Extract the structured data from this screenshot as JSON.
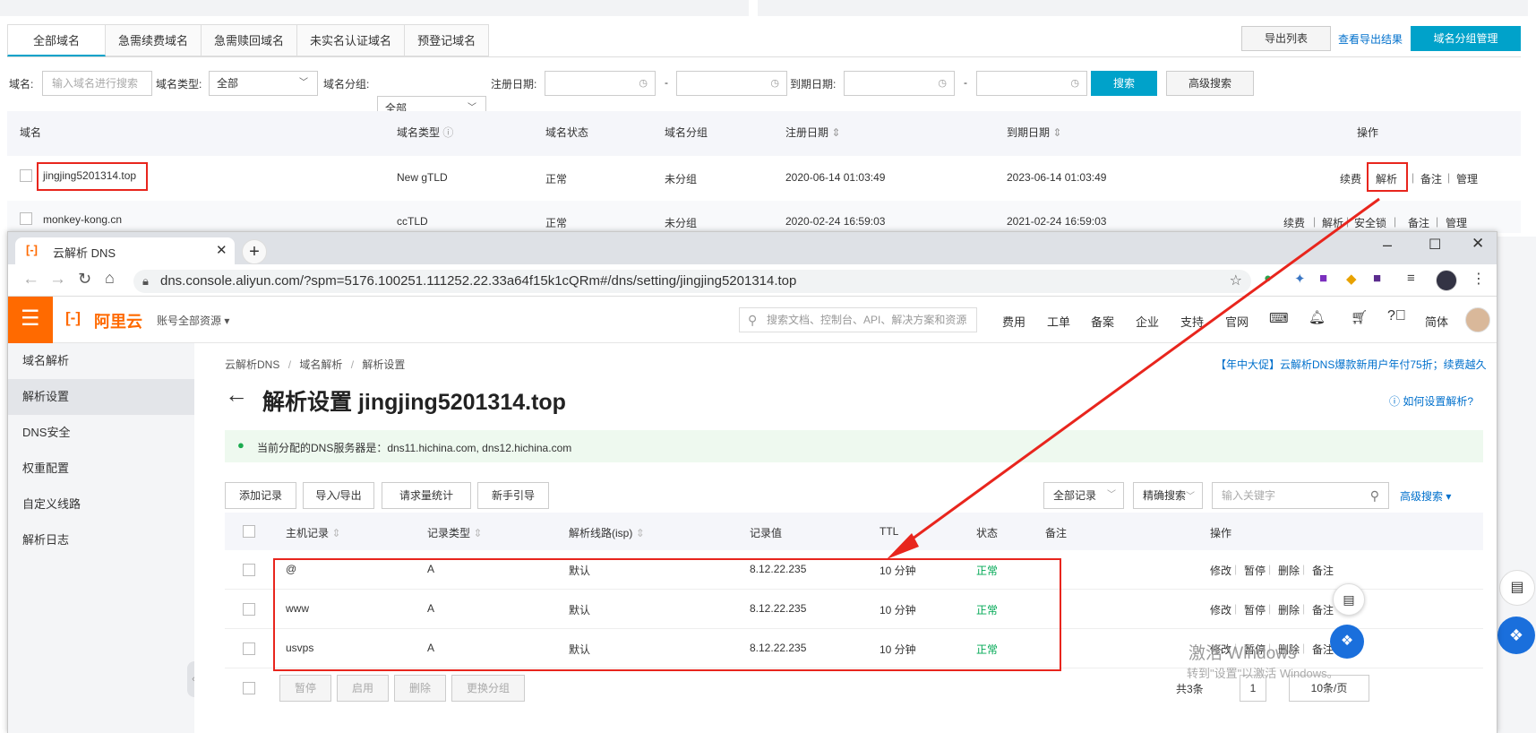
{
  "bg": {
    "tabs": [
      "全部域名",
      "急需续费域名",
      "急需赎回域名",
      "未实名认证域名",
      "预登记域名"
    ],
    "export_list": "导出列表",
    "view_export": "查看导出结果",
    "group_manage": "域名分组管理",
    "filters": {
      "domain_label": "域名:",
      "domain_placeholder": "输入域名进行搜索",
      "type_label": "域名类型:",
      "type_value": "全部",
      "group_label": "域名分组:",
      "group_value": "全部",
      "reg_label": "注册日期:",
      "dash": "-",
      "exp_label": "到期日期:",
      "search": "搜索",
      "advanced": "高级搜索"
    },
    "headers": [
      "域名",
      "域名类型",
      "域名状态",
      "域名分组",
      "注册日期",
      "到期日期",
      "操作"
    ],
    "rows": [
      {
        "domain": "jingjing5201314.top",
        "type": "New gTLD",
        "status": "正常",
        "group": "未分组",
        "reg": "2020-06-14 01:03:49",
        "exp": "2023-06-14 01:03:49",
        "ops": [
          "续费",
          "解析",
          "备注",
          "管理"
        ]
      },
      {
        "domain": "monkey-kong.cn",
        "type": "ccTLD",
        "status": "正常",
        "group": "未分组",
        "reg": "2020-02-24 16:59:03",
        "exp": "2021-02-24 16:59:03",
        "ops": [
          "续费",
          "解析",
          "安全锁",
          "备注",
          "管理"
        ]
      }
    ],
    "sep": "|"
  },
  "browser": {
    "tab_title": "云解析 DNS",
    "url": "dns.console.aliyun.com/?spm=5176.100251.111252.22.33a64f15k1cQRm#/dns/setting/jingjing5201314.top"
  },
  "app": {
    "logo": "阿里云",
    "account": "账号全部资源",
    "search_placeholder": "搜索文档、控制台、API、解决方案和资源",
    "nav": [
      "费用",
      "工单",
      "备案",
      "企业",
      "支持",
      "官网"
    ],
    "lang": "简体"
  },
  "sidebar": {
    "items": [
      "域名解析",
      "解析设置",
      "DNS安全",
      "权重配置",
      "自定义线路",
      "解析日志"
    ]
  },
  "main": {
    "breadcrumb": [
      "云解析DNS",
      "域名解析",
      "解析设置"
    ],
    "breadcrumb_sep": "/",
    "promo": "【年中大促】云解析DNS爆款新用户年付75折；续费越久",
    "title": "解析设置 jingjing5201314.top",
    "help": "如何设置解析?",
    "dns_info": "当前分配的DNS服务器是：dns11.hichina.com, dns12.hichina.com",
    "buttons": [
      "添加记录",
      "导入/导出",
      "请求量统计",
      "新手引导"
    ],
    "record_filter": "全部记录",
    "exact_search": "精确搜索",
    "keyword_placeholder": "输入关键字",
    "advanced_search": "高级搜索",
    "headers": [
      "主机记录",
      "记录类型",
      "解析线路(isp)",
      "记录值",
      "TTL",
      "状态",
      "备注",
      "操作"
    ],
    "records": [
      {
        "host": "@",
        "type": "A",
        "line": "默认",
        "value": "8.12.22.235",
        "ttl": "10 分钟",
        "status": "正常"
      },
      {
        "host": "www",
        "type": "A",
        "line": "默认",
        "value": "8.12.22.235",
        "ttl": "10 分钟",
        "status": "正常"
      },
      {
        "host": "usvps",
        "type": "A",
        "line": "默认",
        "value": "8.12.22.235",
        "ttl": "10 分钟",
        "status": "正常"
      }
    ],
    "row_ops": [
      "修改",
      "暂停",
      "删除",
      "备注"
    ],
    "bottom_buttons": [
      "暂停",
      "启用",
      "删除",
      "更换分组"
    ],
    "total": "共3条",
    "page": "1",
    "per_page": "10条/页",
    "watermark1": "激活 Windows",
    "watermark2": "转到\"设置\"以激活 Windows。"
  },
  "colors": {
    "accent": "#00a2ca",
    "orange": "#ff6a00",
    "red": "#e8251d",
    "link": "#0070cc",
    "green": "#00a854"
  }
}
